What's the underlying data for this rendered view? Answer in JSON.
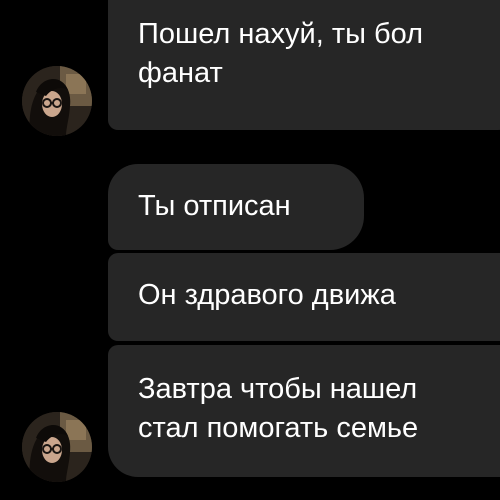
{
  "messages": [
    {
      "text_lines": [
        "Пошел нахуй, ты бол",
        "фанат"
      ]
    },
    {
      "text_lines": [
        "Ты отписан"
      ]
    },
    {
      "text_lines": [
        "Он здравого движа"
      ]
    },
    {
      "text_lines": [
        "Завтра чтобы нашел",
        "стал помогать семье"
      ]
    }
  ],
  "avatar_icon": "user-avatar-photo",
  "colors": {
    "background": "#000000",
    "bubble": "#262626",
    "text": "#ffffff"
  }
}
